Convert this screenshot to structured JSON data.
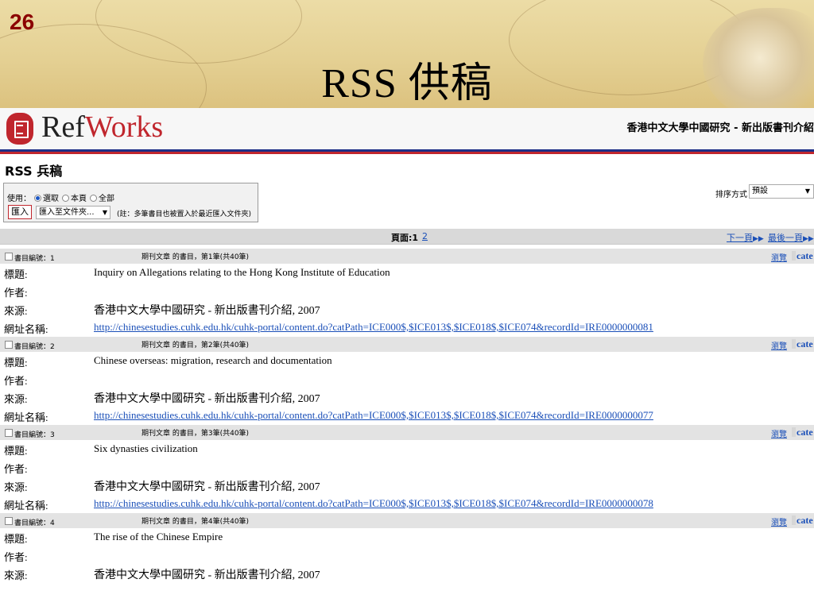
{
  "slide": {
    "number": "26",
    "title": "RSS 供稿"
  },
  "refworks": {
    "logo_ref": "Ref",
    "logo_works": "Works",
    "org_title": "香港中文大學中國研究 - 新出版書刊介紹"
  },
  "section_title": "RSS 兵稿",
  "options": {
    "use_label": "使用：",
    "radios": [
      "選取",
      "本頁",
      "全部"
    ],
    "selected_radio": "選取",
    "import_button": "匯入",
    "import_select": "匯入至文件夾...",
    "import_note": "(註：多筆書目也被置入於最近匯入文件夾)"
  },
  "sort": {
    "label": "排序方式",
    "value": "預設"
  },
  "pager": {
    "label": "頁面:1",
    "page_2": "2",
    "next": "下一頁",
    "last": "最後一頁"
  },
  "records": [
    {
      "num": "書目編號：1",
      "info": "期刊文章 的書目，第1筆(共40筆)",
      "view": "瀏覽",
      "cate": "cate",
      "fields": [
        {
          "label": "標題:",
          "value": "Inquiry on Allegations relating to the Hong Kong Institute of Education"
        },
        {
          "label": "作者:",
          "value": ""
        },
        {
          "label": "來源:",
          "value": "香港中文大學中國研究 - 新出版書刊介紹, 2007"
        },
        {
          "label": "網址名稱:",
          "value": "http://chinesestudies.cuhk.edu.hk/cuhk-portal/content.do?catPath=ICE000$,$ICE013$,$ICE018$,$ICE074&recordId=IRE0000000081"
        }
      ]
    },
    {
      "num": "書目編號：2",
      "info": "期刊文章 的書目，第2筆(共40筆)",
      "view": "瀏覽",
      "cate": "cate",
      "fields": [
        {
          "label": "標題:",
          "value": "Chinese overseas: migration, research and documentation"
        },
        {
          "label": "作者:",
          "value": ""
        },
        {
          "label": "來源:",
          "value": "香港中文大學中國研究 - 新出版書刊介紹, 2007"
        },
        {
          "label": "網址名稱:",
          "value": "http://chinesestudies.cuhk.edu.hk/cuhk-portal/content.do?catPath=ICE000$,$ICE013$,$ICE018$,$ICE074&recordId=IRE0000000077"
        }
      ]
    },
    {
      "num": "書目編號：3",
      "info": "期刊文章 的書目，第3筆(共40筆)",
      "view": "瀏覽",
      "cate": "cate",
      "fields": [
        {
          "label": "標題:",
          "value": "Six dynasties civilization"
        },
        {
          "label": "作者:",
          "value": ""
        },
        {
          "label": "來源:",
          "value": "香港中文大學中國研究 - 新出版書刊介紹, 2007"
        },
        {
          "label": "網址名稱:",
          "value": "http://chinesestudies.cuhk.edu.hk/cuhk-portal/content.do?catPath=ICE000$,$ICE013$,$ICE018$,$ICE074&recordId=IRE0000000078"
        }
      ]
    },
    {
      "num": "書目編號：4",
      "info": "期刊文章 的書目，第4筆(共40筆)",
      "view": "瀏覽",
      "cate": "cate",
      "fields": [
        {
          "label": "標題:",
          "value": "The rise of the Chinese Empire"
        },
        {
          "label": "作者:",
          "value": ""
        },
        {
          "label": "來源:",
          "value": "香港中文大學中國研究 - 新出版書刊介紹, 2007"
        }
      ]
    }
  ],
  "colors": {
    "brand_red": "#c0262d",
    "brand_blue": "#1d2f87",
    "link_blue": "#1a4fb8",
    "slide_number": "#8b0000"
  }
}
